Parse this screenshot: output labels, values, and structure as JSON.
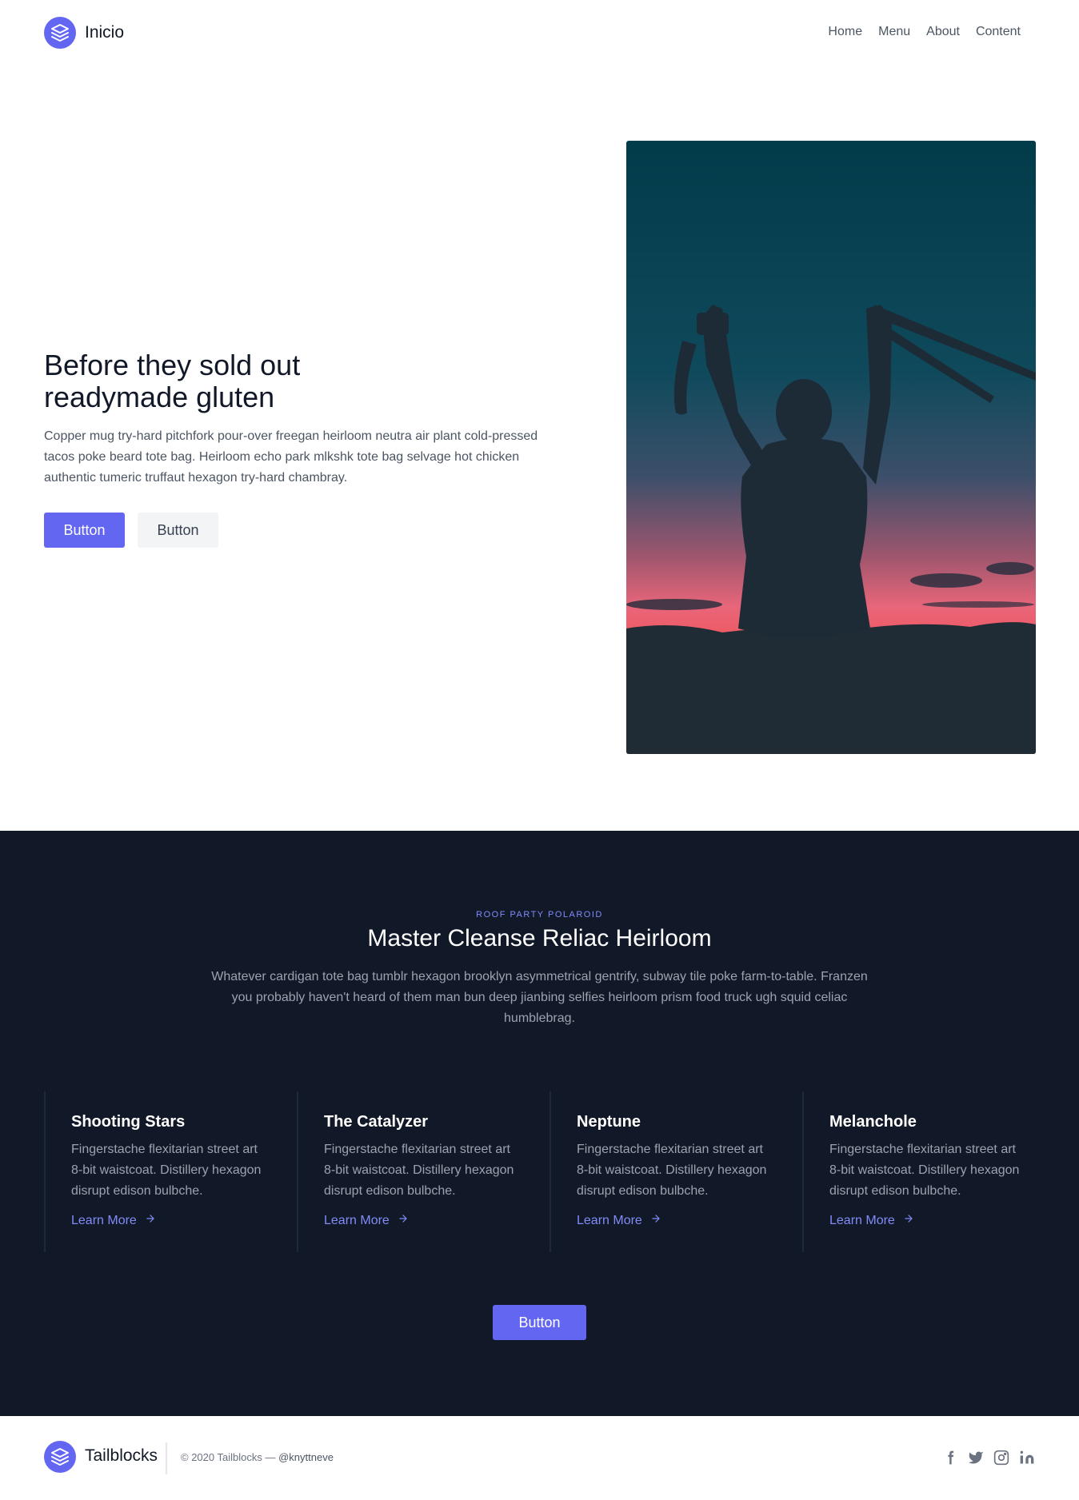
{
  "header": {
    "brand": "Inicio",
    "nav": [
      "Home",
      "Menu",
      "About",
      "Content"
    ]
  },
  "hero": {
    "title_line1": "Before they sold out",
    "title_line2": "readymade gluten",
    "text": "Copper mug try-hard pitchfork pour-over freegan heirloom neutra air plant cold-pressed tacos poke beard tote bag. Heirloom echo park mlkshk tote bag selvage hot chicken authentic tumeric truffaut hexagon try-hard chambray.",
    "primary_button": "Button",
    "secondary_button": "Button"
  },
  "section": {
    "eyebrow": "ROOF PARTY POLAROID",
    "title": "Master Cleanse Reliac Heirloom",
    "text": "Whatever cardigan tote bag tumblr hexagon brooklyn asymmetrical gentrify, subway tile poke farm-to-table. Franzen you probably haven't heard of them man bun deep jianbing selfies heirloom prism food truck ugh squid celiac humblebrag.",
    "features": [
      {
        "title": "Shooting Stars",
        "text": "Fingerstache flexitarian street art 8-bit waistcoat. Distillery hexagon disrupt edison bulbche.",
        "link": "Learn More"
      },
      {
        "title": "The Catalyzer",
        "text": "Fingerstache flexitarian street art 8-bit waistcoat. Distillery hexagon disrupt edison bulbche.",
        "link": "Learn More"
      },
      {
        "title": "Neptune",
        "text": "Fingerstache flexitarian street art 8-bit waistcoat. Distillery hexagon disrupt edison bulbche.",
        "link": "Learn More"
      },
      {
        "title": "Melanchole",
        "text": "Fingerstache flexitarian street art 8-bit waistcoat. Distillery hexagon disrupt edison bulbche.",
        "link": "Learn More"
      }
    ],
    "button": "Button"
  },
  "footer": {
    "brand": "Tailblocks",
    "copyright": "© 2020 Tailblocks —",
    "handle": "@knyttneve",
    "social_icons": [
      "facebook-icon",
      "twitter-icon",
      "instagram-icon",
      "linkedin-icon"
    ]
  },
  "colors": {
    "accent": "#6366f1",
    "dark_bg": "#111827",
    "accent_light": "#818cf8"
  }
}
